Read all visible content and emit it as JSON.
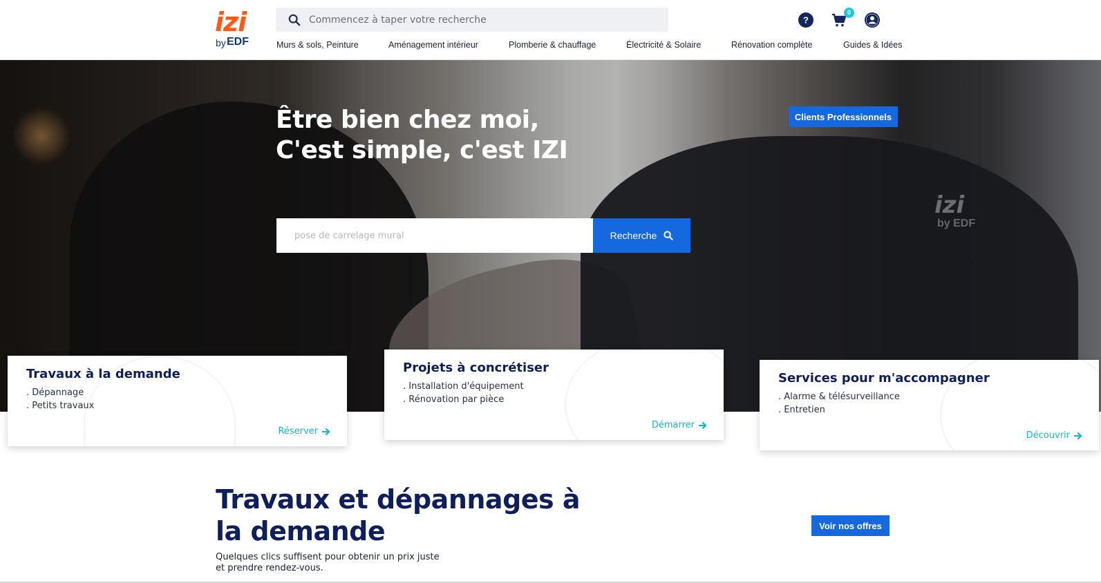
{
  "header": {
    "logo": {
      "brand": "izi",
      "by": "by",
      "company": "EDF"
    },
    "search": {
      "placeholder": "Commencez à taper votre recherche"
    },
    "cart_count": "0",
    "nav": [
      "Murs & sols, Peinture",
      "Aménagement intérieur",
      "Plomberie & chauffage",
      "Électricité & Solaire",
      "Rénovation complète",
      "Guides & Idées"
    ],
    "icons": [
      "search-icon",
      "help-icon",
      "cart-icon",
      "user-icon"
    ]
  },
  "hero": {
    "title_line1": "Être bien chez moi,",
    "title_line2": "C'est simple, c'est IZI",
    "pro_button": "Clients Professionnels",
    "search": {
      "placeholder": "pose de carrelage mural",
      "button": "Recherche"
    },
    "watermark": {
      "brand": "izi",
      "by": "by EDF"
    }
  },
  "cards": [
    {
      "title": "Travaux à la demande",
      "lines": [
        ". Dépannage",
        ". Petits travaux"
      ],
      "link": "Réserver"
    },
    {
      "title": "Projets à concrétiser",
      "lines": [
        ". Installation d'équipement",
        ". Rénovation par pièce"
      ],
      "link": "Démarrer"
    },
    {
      "title": "Services pour m'accompagner",
      "lines": [
        ". Alarme & télésurveillance",
        ". Entretien"
      ],
      "link": "Découvrir"
    }
  ],
  "section": {
    "title_line1": "Travaux et dépannages à",
    "title_line2": "la demande",
    "subtitle": "Quelques clics suffisent pour obtenir un prix juste et prendre rendez-vous.",
    "button": "Voir nos offres"
  },
  "colors": {
    "brand_orange": "#fe5815",
    "navy": "#0f1f5c",
    "primary_blue": "#1668df",
    "link_teal": "#18b3c6",
    "badge_cyan": "#1fc8d8"
  }
}
